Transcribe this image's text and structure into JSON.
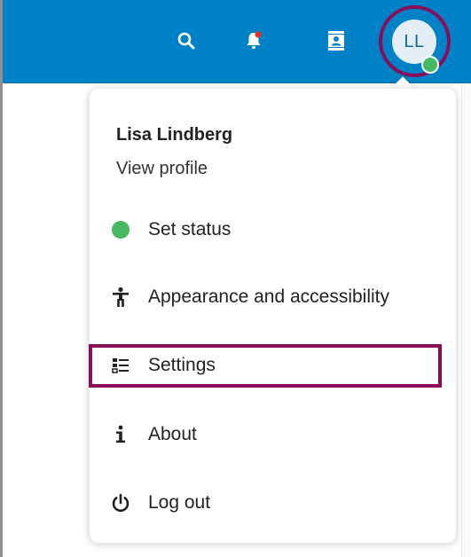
{
  "header": {
    "icons": [
      "search-icon",
      "notifications-bell-icon",
      "contacts-icon"
    ],
    "background_color": "#0082c9"
  },
  "user": {
    "initials": "LL",
    "name": "Lisa Lindberg",
    "view_profile_label": "View profile",
    "status_color": "#46ba61"
  },
  "menu": {
    "items": [
      {
        "label": "Set status",
        "icon": "status-dot-icon"
      },
      {
        "label": "Appearance and accessibility",
        "icon": "accessibility-icon"
      },
      {
        "label": "Settings",
        "icon": "settings-list-icon"
      },
      {
        "label": "About",
        "icon": "info-icon"
      },
      {
        "label": "Log out",
        "icon": "power-icon"
      }
    ]
  },
  "highlight_color": "#8a0d57"
}
